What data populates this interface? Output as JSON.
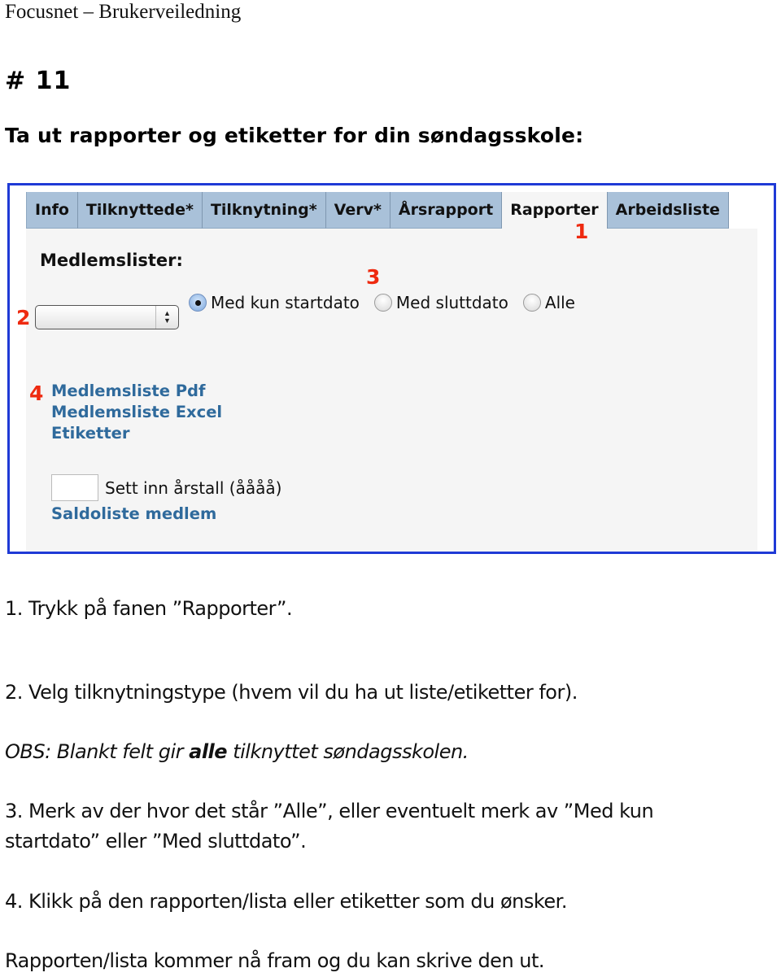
{
  "document": {
    "header": "Focusnet – Brukerveiledning",
    "section_number": "# 11",
    "section_title": "Ta ut rapporter og etiketter for din søndagsskole:"
  },
  "screenshot": {
    "frame_color": "#1f3ad6",
    "annotation_color": "#ee2a10",
    "tabs": [
      {
        "label": "Info",
        "active": false
      },
      {
        "label": "Tilknyttede*",
        "active": false
      },
      {
        "label": "Tilknytning*",
        "active": false
      },
      {
        "label": "Verv*",
        "active": false
      },
      {
        "label": "Årsrapport",
        "active": false
      },
      {
        "label": "Rapporter",
        "active": true
      },
      {
        "label": "Arbeidsliste",
        "active": false
      }
    ],
    "annotations": {
      "a1": "1",
      "a2": "2",
      "a3": "3",
      "a4": "4"
    },
    "section_label": "Medlemslister:",
    "select": {
      "value": "",
      "arrow_up": "▲",
      "arrow_down": "▼"
    },
    "radio_options": [
      {
        "label": "Med kun startdato",
        "checked": true
      },
      {
        "label": "Med sluttdato",
        "checked": false
      },
      {
        "label": "Alle",
        "checked": false
      }
    ],
    "report_links": [
      "Medlemsliste Pdf",
      "Medlemsliste Excel",
      "Etiketter"
    ],
    "year_input": {
      "value": "",
      "label": "Sett inn årstall (åååå)"
    },
    "saldo_link": "Saldoliste medlem",
    "link_color": "#2f6a9c",
    "tab_color": "#a9c1d9"
  },
  "instructions": {
    "step1": "1. Trykk på fanen ”Rapporter”.",
    "step2": "2. Velg tilknytningstype (hvem vil du ha ut liste/etiketter for).",
    "obs_prefix": "OBS: Blankt felt gir ",
    "obs_bold": "alle",
    "obs_suffix": " tilknyttet søndagsskolen.",
    "step3_line1": "3. Merk av der hvor det står ”Alle”, eller eventuelt merk av ”Med kun",
    "step3_line2": "startdato” eller ”Med sluttdato”.",
    "step4": "4. Klikk på den rapporten/lista eller etiketter som du ønsker.",
    "closing": "Rapporten/lista kommer nå fram og du kan skrive den ut."
  }
}
